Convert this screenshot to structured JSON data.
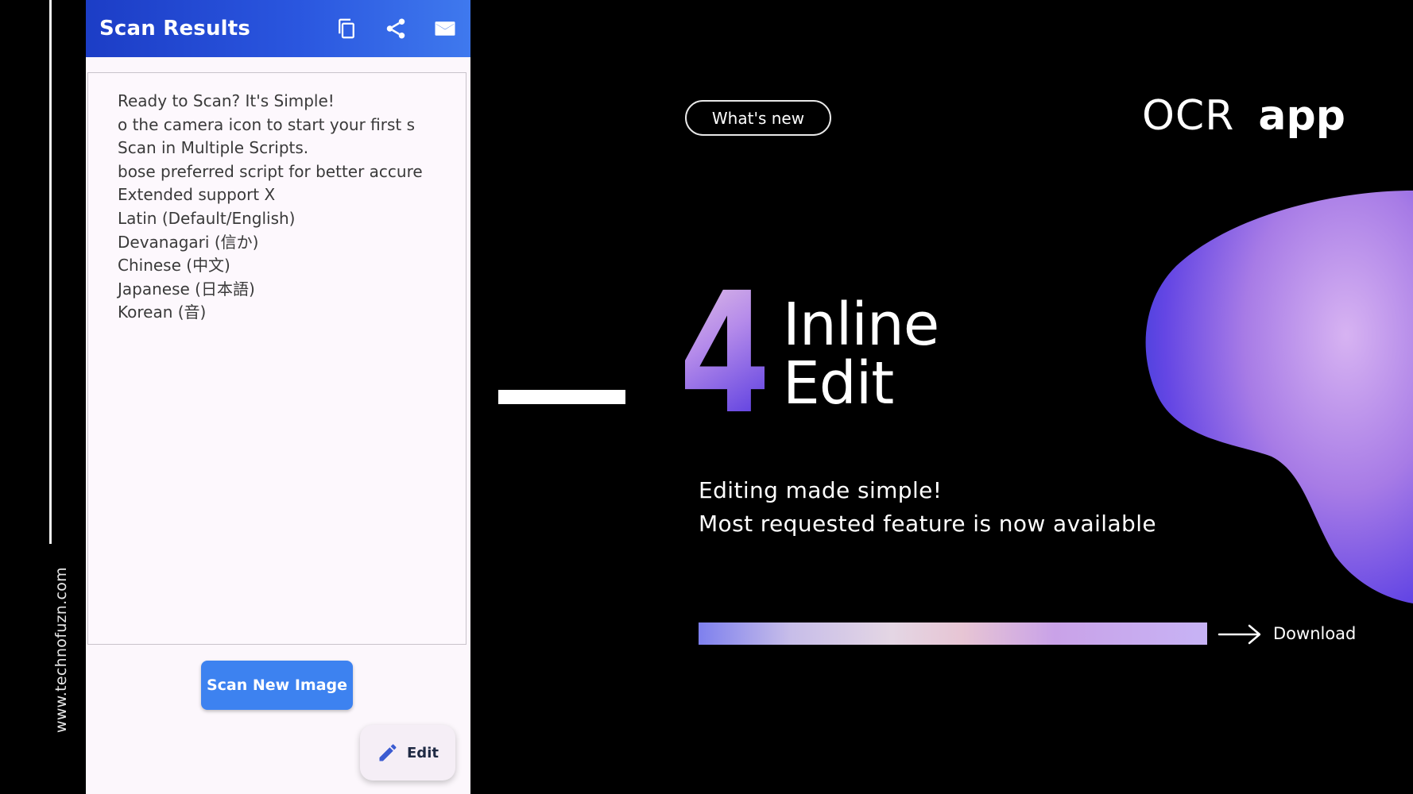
{
  "site": {
    "url": "www.technofuzn.com"
  },
  "phone": {
    "appbar": {
      "title": "Scan Results",
      "icons": [
        "copy-icon",
        "share-icon",
        "mail-icon"
      ]
    },
    "scan_text": [
      "Ready to Scan? It's Simple!",
      "o the camera icon to start your first s",
      "Scan in Multiple Scripts.",
      "bose preferred script for better accure",
      "Extended support X",
      "Latin (Default/English)",
      "Devanagari (信か)",
      "Chinese (中文)",
      "Japanese (日本語)",
      "Korean (音)"
    ],
    "scan_button": "Scan New Image",
    "edit_button": "Edit"
  },
  "promo": {
    "badge": "What's new",
    "brand_light": "OCR",
    "brand_bold": "app",
    "number": "4",
    "heading_line1": "Inline",
    "heading_line2": "Edit",
    "desc_line1": "Editing made simple!",
    "desc_line2": "Most requested feature is now available",
    "download": "Download"
  },
  "colors": {
    "appbar_start": "#1c3dc6",
    "appbar_end": "#3f79ee",
    "button": "#3d82f0",
    "phone_bg": "#fcf7fc",
    "accent_purple": "#8b5cf6"
  }
}
